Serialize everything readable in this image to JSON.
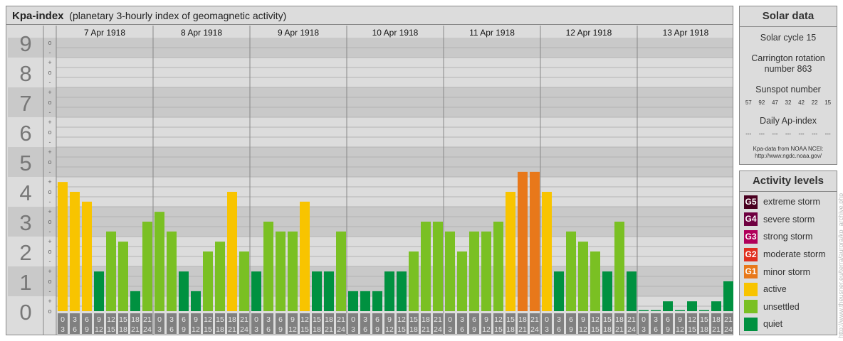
{
  "title": {
    "main": "Kpa-index",
    "sub": "(planetary 3-hourly index of geomagnetic activity)"
  },
  "chart_data": {
    "type": "bar",
    "title": "Kpa-index",
    "ylabel": "Kp",
    "ylim": [
      0,
      9
    ],
    "y_ticks": [
      "0",
      "1",
      "2",
      "3",
      "4",
      "5",
      "6",
      "7",
      "8",
      "9"
    ],
    "minor_ticks": [
      "-",
      "o",
      "+"
    ],
    "days": [
      "7 Apr 1918",
      "8 Apr 1918",
      "9 Apr 1918",
      "10 Apr 1918",
      "11 Apr 1918",
      "12 Apr 1918",
      "13 Apr 1918"
    ],
    "intervals": [
      [
        "0",
        "3"
      ],
      [
        "3",
        "6"
      ],
      [
        "6",
        "9"
      ],
      [
        "9",
        "12"
      ],
      [
        "12",
        "15"
      ],
      [
        "15",
        "18"
      ],
      [
        "18",
        "21"
      ],
      [
        "21",
        "24"
      ]
    ],
    "series": [
      {
        "name": "7 Apr 1918",
        "values": [
          4.33,
          4.0,
          3.67,
          1.33,
          2.67,
          2.33,
          0.67,
          3.0
        ]
      },
      {
        "name": "8 Apr 1918",
        "values": [
          3.33,
          2.67,
          1.33,
          0.67,
          2.0,
          2.33,
          4.0,
          2.0
        ]
      },
      {
        "name": "9 Apr 1918",
        "values": [
          1.33,
          3.0,
          2.67,
          2.67,
          3.67,
          1.33,
          1.33,
          2.67
        ]
      },
      {
        "name": "10 Apr 1918",
        "values": [
          0.67,
          0.67,
          0.67,
          1.33,
          1.33,
          2.0,
          3.0,
          3.0
        ]
      },
      {
        "name": "11 Apr 1918",
        "values": [
          2.67,
          2.0,
          2.67,
          2.67,
          3.0,
          4.0,
          4.67,
          4.67
        ]
      },
      {
        "name": "12 Apr 1918",
        "values": [
          4.0,
          1.33,
          2.67,
          2.33,
          2.0,
          1.33,
          3.0,
          1.33
        ]
      },
      {
        "name": "13 Apr 1918",
        "values": [
          0,
          0,
          0.33,
          0,
          0.33,
          0,
          0.33,
          1.0
        ]
      }
    ]
  },
  "colors": {
    "quiet": "#009140",
    "unsettled": "#7ac023",
    "active": "#f8c400",
    "minor": "#e8781a",
    "g2": "#e03020",
    "g3": "#b0005a",
    "g4": "#6e0040",
    "g5": "#4a0020"
  },
  "solar": {
    "header": "Solar data",
    "cycle": "Solar cycle 15",
    "carrington1": "Carrington rotation",
    "carrington2": "number 863",
    "sunspot_label": "Sunspot number",
    "sunspots": [
      "57",
      "92",
      "47",
      "32",
      "42",
      "22",
      "15"
    ],
    "ap_label": "Daily Ap-index",
    "ap": [
      "---",
      "---",
      "---",
      "---",
      "---",
      "---",
      "---"
    ],
    "source1": "Kpa-data from NOAA NCEI:",
    "source2": "http://www.ngdc.noaa.gov/"
  },
  "levels": {
    "header": "Activity levels",
    "items": [
      {
        "badge": "G5",
        "label": "extreme storm",
        "color": "#4a0020"
      },
      {
        "badge": "G4",
        "label": "severe storm",
        "color": "#6e0040"
      },
      {
        "badge": "G3",
        "label": "strong storm",
        "color": "#b0005a"
      },
      {
        "badge": "G2",
        "label": "moderate storm",
        "color": "#e03020"
      },
      {
        "badge": "G1",
        "label": "minor storm",
        "color": "#e8781a"
      },
      {
        "badge": "",
        "label": "active",
        "color": "#f8c400"
      },
      {
        "badge": "",
        "label": "unsettled",
        "color": "#7ac023"
      },
      {
        "badge": "",
        "label": "quiet",
        "color": "#009140"
      }
    ]
  },
  "watermark": "http://www.theusner.eu/terra/aurora/kp_archive.php"
}
